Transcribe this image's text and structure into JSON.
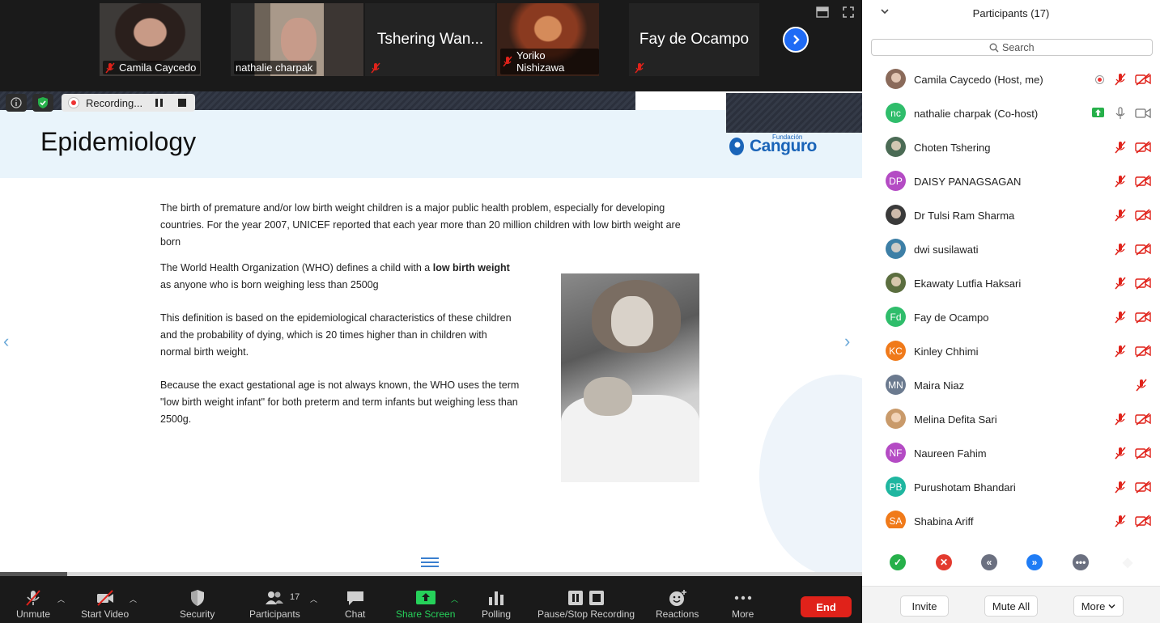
{
  "video_strip": {
    "tiles": [
      {
        "name": "Camila Caycedo",
        "muted": true
      },
      {
        "name": "nathalie charpak",
        "muted": false,
        "active": true
      },
      {
        "name": "Tshering Wan...",
        "muted": true
      },
      {
        "name": "Yoriko Nishizawa",
        "muted": true
      },
      {
        "name": "Fay de Ocampo",
        "muted": true
      }
    ]
  },
  "recording": {
    "label": "Recording..."
  },
  "slide": {
    "title": "Epidemiology",
    "logo_small": "Fundación",
    "logo_word": "Canguro",
    "p1": "The birth of premature and/or low birth weight children is a major public health problem, especially for developing countries. For the year 2007, UNICEF reported that each year more than 20 million children with low birth weight are born",
    "p2_pre": "The World Health Organization (WHO) defines a child with a ",
    "p2_bold": "low birth weight",
    "p2_post": " as anyone who is born weighing less than 2500g",
    "p3": "This definition is based on the epidemiological characteristics of these children and the probability of dying, which is 20 times higher than in children with normal birth weight.",
    "p4": "Because the exact gestational age is not always known, the WHO uses the term \"low birth weight infant\" for both preterm and term infants but weighing less than 2500g.",
    "prev_arrow": "‹",
    "next_arrow": "›",
    "progress": 0.078
  },
  "toolbar": {
    "unmute": "Unmute",
    "start_video": "Start Video",
    "security": "Security",
    "participants": "Participants",
    "participants_count": "17",
    "chat": "Chat",
    "share_screen": "Share Screen",
    "polling": "Polling",
    "pause_stop": "Pause/Stop Recording",
    "reactions": "Reactions",
    "more": "More",
    "end": "End"
  },
  "panel": {
    "title": "Participants (17)",
    "search_placeholder": "Search",
    "participants": [
      {
        "name": "Camila Caycedo (Host, me)",
        "initials": "",
        "color": "#8a6a5a",
        "photo": true,
        "mic": "off",
        "cam": "off",
        "rec": true
      },
      {
        "name": "nathalie charpak (Co-host)",
        "initials": "nc",
        "color": "#2fbd6b",
        "photo": false,
        "mic": "on",
        "cam": "on",
        "share": true
      },
      {
        "name": "Choten Tshering",
        "initials": "",
        "color": "#4b6b55",
        "photo": true,
        "mic": "off",
        "cam": "off"
      },
      {
        "name": "DAISY PANAGSAGAN",
        "initials": "DP",
        "color": "#b44bc4",
        "photo": false,
        "mic": "off",
        "cam": "off"
      },
      {
        "name": "Dr Tulsi Ram Sharma",
        "initials": "",
        "color": "#3a3a3a",
        "photo": true,
        "mic": "off",
        "cam": "off"
      },
      {
        "name": "dwi susilawati",
        "initials": "",
        "color": "#3d7fa6",
        "photo": true,
        "mic": "off",
        "cam": "off"
      },
      {
        "name": "Ekawaty Lutfia Haksari",
        "initials": "",
        "color": "#5b6e3f",
        "photo": true,
        "mic": "off",
        "cam": "off"
      },
      {
        "name": "Fay de Ocampo",
        "initials": "Fd",
        "color": "#2fbd6b",
        "photo": false,
        "mic": "off",
        "cam": "off"
      },
      {
        "name": "Kinley Chhimi",
        "initials": "KC",
        "color": "#f07a1a",
        "photo": false,
        "mic": "off",
        "cam": "off"
      },
      {
        "name": "Maira Niaz",
        "initials": "MN",
        "color": "#6b7a8f",
        "photo": false,
        "mic": "off",
        "cam": "none"
      },
      {
        "name": "Melina Defita Sari",
        "initials": "",
        "color": "#c99a6a",
        "photo": true,
        "mic": "off",
        "cam": "off"
      },
      {
        "name": "Naureen Fahim",
        "initials": "NF",
        "color": "#b44bc4",
        "photo": false,
        "mic": "off",
        "cam": "off"
      },
      {
        "name": "Purushotam Bhandari",
        "initials": "PB",
        "color": "#1fb6a0",
        "photo": false,
        "mic": "off",
        "cam": "off"
      },
      {
        "name": "Shabina Ariff",
        "initials": "SA",
        "color": "#f07a1a",
        "photo": false,
        "mic": "off",
        "cam": "off"
      }
    ],
    "reactions": [
      {
        "icon": "check-icon",
        "symbol": "✓",
        "color": "#26b04a"
      },
      {
        "icon": "x-icon",
        "symbol": "✕",
        "color": "#e33a2e"
      },
      {
        "icon": "slower-icon",
        "symbol": "«",
        "color": "#6b7080"
      },
      {
        "icon": "faster-icon",
        "symbol": "»",
        "color": "#1f7cf5"
      },
      {
        "icon": "more-reactions-icon",
        "symbol": "•••",
        "color": "#6b7080"
      },
      {
        "icon": "clear-icon",
        "symbol": "◆",
        "color": "#e6e6e6"
      }
    ],
    "invite": "Invite",
    "mute_all": "Mute All",
    "more": "More"
  },
  "colors": {
    "accent_blue": "#1f6bf5",
    "end_red": "#e0221a",
    "share_green": "#26d15a",
    "mute_red": "#e0221a"
  }
}
